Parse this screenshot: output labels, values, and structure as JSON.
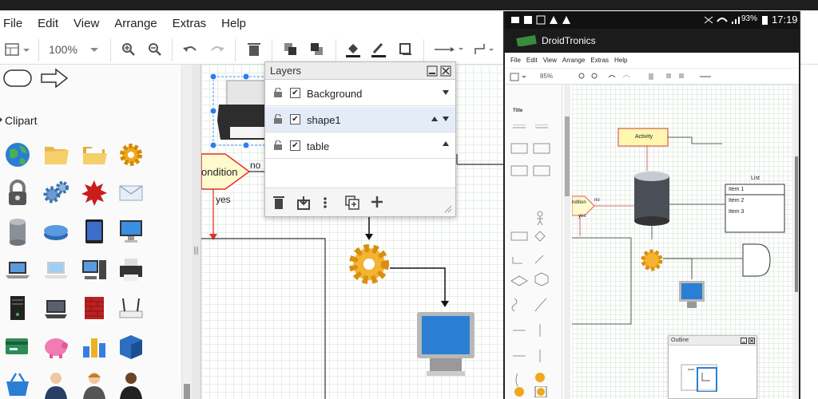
{
  "menu": {
    "items": [
      "File",
      "Edit",
      "View",
      "Arrange",
      "Extras",
      "Help"
    ]
  },
  "toolbar": {
    "zoom": "100%"
  },
  "sidebar": {
    "clipart_label": "Clipart"
  },
  "canvas": {
    "condition_label": "ondition",
    "no_label": "no",
    "yes_label": "yes"
  },
  "layers": {
    "title": "Layers",
    "rows": [
      {
        "name": "Background",
        "checked": true
      },
      {
        "name": "shape1",
        "checked": true
      },
      {
        "name": "table",
        "checked": true
      }
    ]
  },
  "phone": {
    "status_time": "17:19",
    "battery": "93%",
    "app_title": "DroidTronics",
    "menu": [
      "File",
      "Edit",
      "View",
      "Arrange",
      "Extras",
      "Help"
    ],
    "zoom": "85%",
    "sidebar_title": "Title",
    "activity_label": "Activity",
    "list_title": "List",
    "list_items": [
      "Item 1",
      "Item 2",
      "Item 3"
    ],
    "condition_label": "ndition",
    "no_label": "no",
    "yes_label": "yes",
    "outline_title": "Outline"
  },
  "colors": {
    "accent": "#4a8ef0",
    "topbar": "#1e1e1e",
    "grid": "#e6eee6",
    "diamond_fill": "#fffacd",
    "diamond_stroke": "#e03030"
  }
}
